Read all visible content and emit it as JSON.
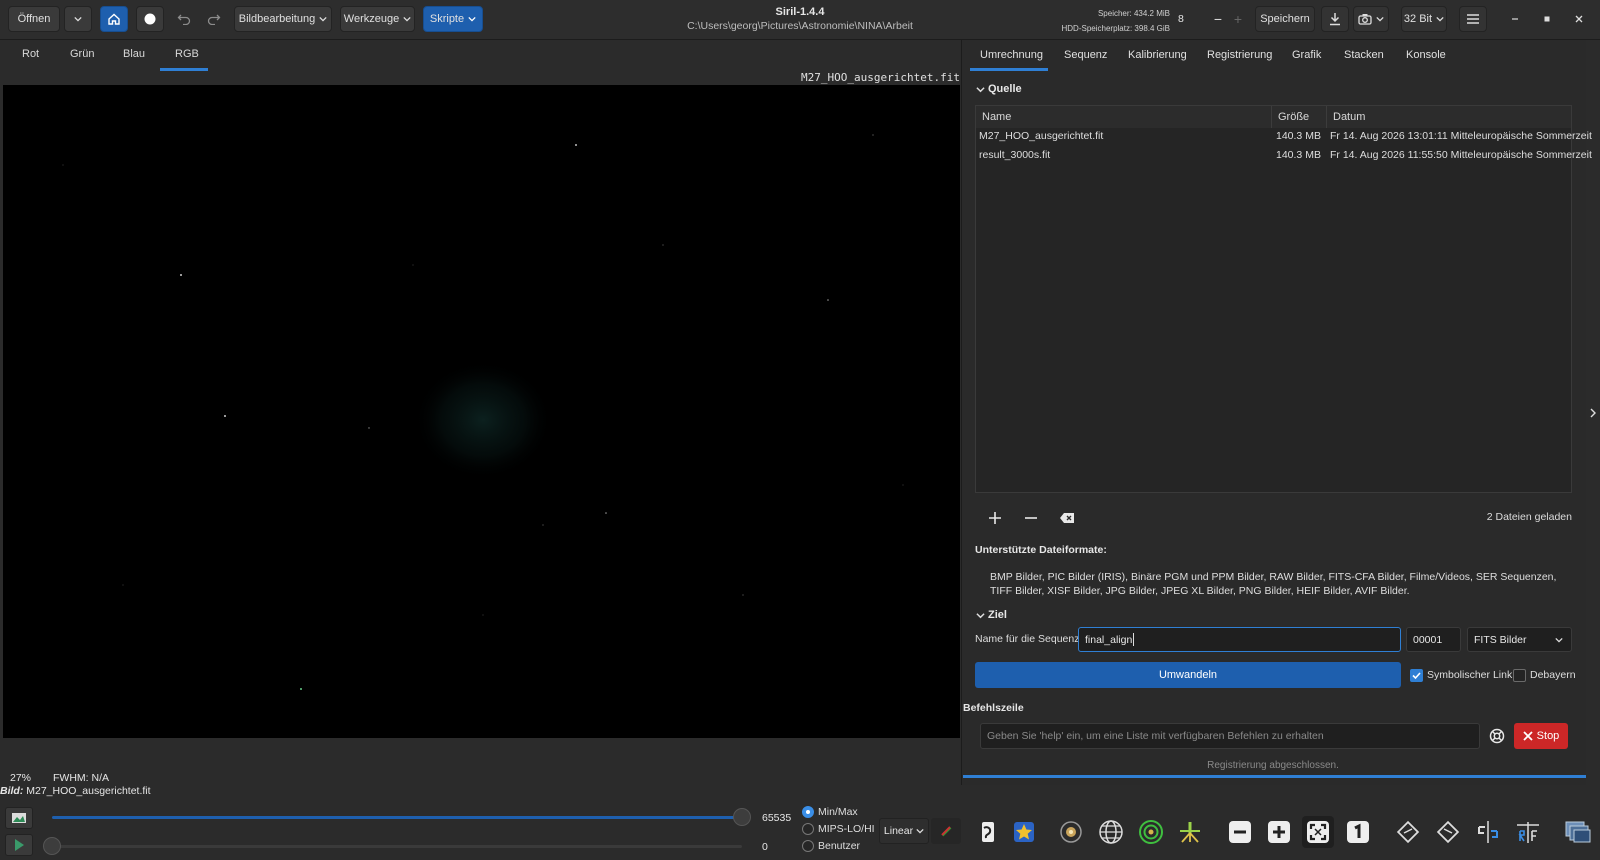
{
  "header": {
    "open_label": "Öffnen",
    "image_processing": "Bildbearbeitung",
    "tools": "Werkzeuge",
    "scripts": "Skripte",
    "app_title": "Siril-1.4.4",
    "working_dir": "C:\\Users\\georg\\Pictures\\Astronomie\\NINA\\Arbeit",
    "memory": "Speicher: 434.2 MiB",
    "disk": "HDD-Speicherplatz: 398.4 GiB",
    "threads_value": "8",
    "save_label": "Speichern",
    "bit_depth": "32 Bit"
  },
  "channels": {
    "tabs": [
      "Rot",
      "Grün",
      "Blau",
      "RGB"
    ],
    "active": "RGB"
  },
  "image": {
    "filename": "M27_HOO_ausgerichtet.fit"
  },
  "right_tabs": {
    "items": [
      "Umrechnung",
      "Sequenz",
      "Kalibrierung",
      "Registrierung",
      "Grafik",
      "Stacken",
      "Konsole"
    ],
    "active": "Umrechnung"
  },
  "source": {
    "title": "Quelle",
    "columns": [
      "Name",
      "Größe",
      "Datum"
    ],
    "rows": [
      [
        "M27_HOO_ausgerichtet.fit",
        "140.3 MB",
        "Fr 14. Aug 2026 13:01:11 Mitteleuropäische Sommerzeit"
      ],
      [
        "result_3000s.fit",
        "140.3 MB",
        "Fr 14. Aug 2026 11:55:50 Mitteleuropäische Sommerzeit"
      ]
    ],
    "files_loaded": "2 Dateien geladen"
  },
  "formats": {
    "title": "Unterstützte Dateiformate:",
    "text": "BMP Bilder, PIC Bilder (IRIS), Binäre PGM und PPM Bilder, RAW Bilder, FITS-CFA Bilder, Filme/Videos, SER Sequenzen, TIFF Bilder, XISF Bilder, JPG Bilder, JPEG XL Bilder, PNG Bilder, HEIF Bilder, AVIF Bilder."
  },
  "target": {
    "title": "Ziel",
    "seq_label": "Name für die Sequenz:",
    "seq_name": "final_align",
    "start_index": "00001",
    "output_format": "FITS Bilder",
    "convert_label": "Umwandeln",
    "symlink_label": "Symbolischer Link",
    "symlink_checked": true,
    "debayer_label": "Debayern",
    "debayer_checked": false
  },
  "command": {
    "title": "Befehlszeile",
    "placeholder": "Geben Sie 'help' ein, um eine Liste mit verfügbaren Befehlen zu erhalten",
    "stop_label": "Stop",
    "status": "Registrierung abgeschlossen."
  },
  "status_bar": {
    "zoom": "27%",
    "fwhm": "FWHM:  N/A",
    "image_label": "Bild:",
    "image_name": "M27_HOO_ausgerichtet.fit"
  },
  "display": {
    "high_value": "65535",
    "low_value": "0",
    "high_fraction": 1.0,
    "low_fraction": 0.0,
    "modes": [
      "Min/Max",
      "MIPS-LO/HI",
      "Benutzer"
    ],
    "selected_mode": "Min/Max",
    "stretch": "Linear"
  },
  "colors": {
    "accent": "#1e5fae",
    "stop": "#cc2727",
    "background": "#2b2b2b"
  }
}
